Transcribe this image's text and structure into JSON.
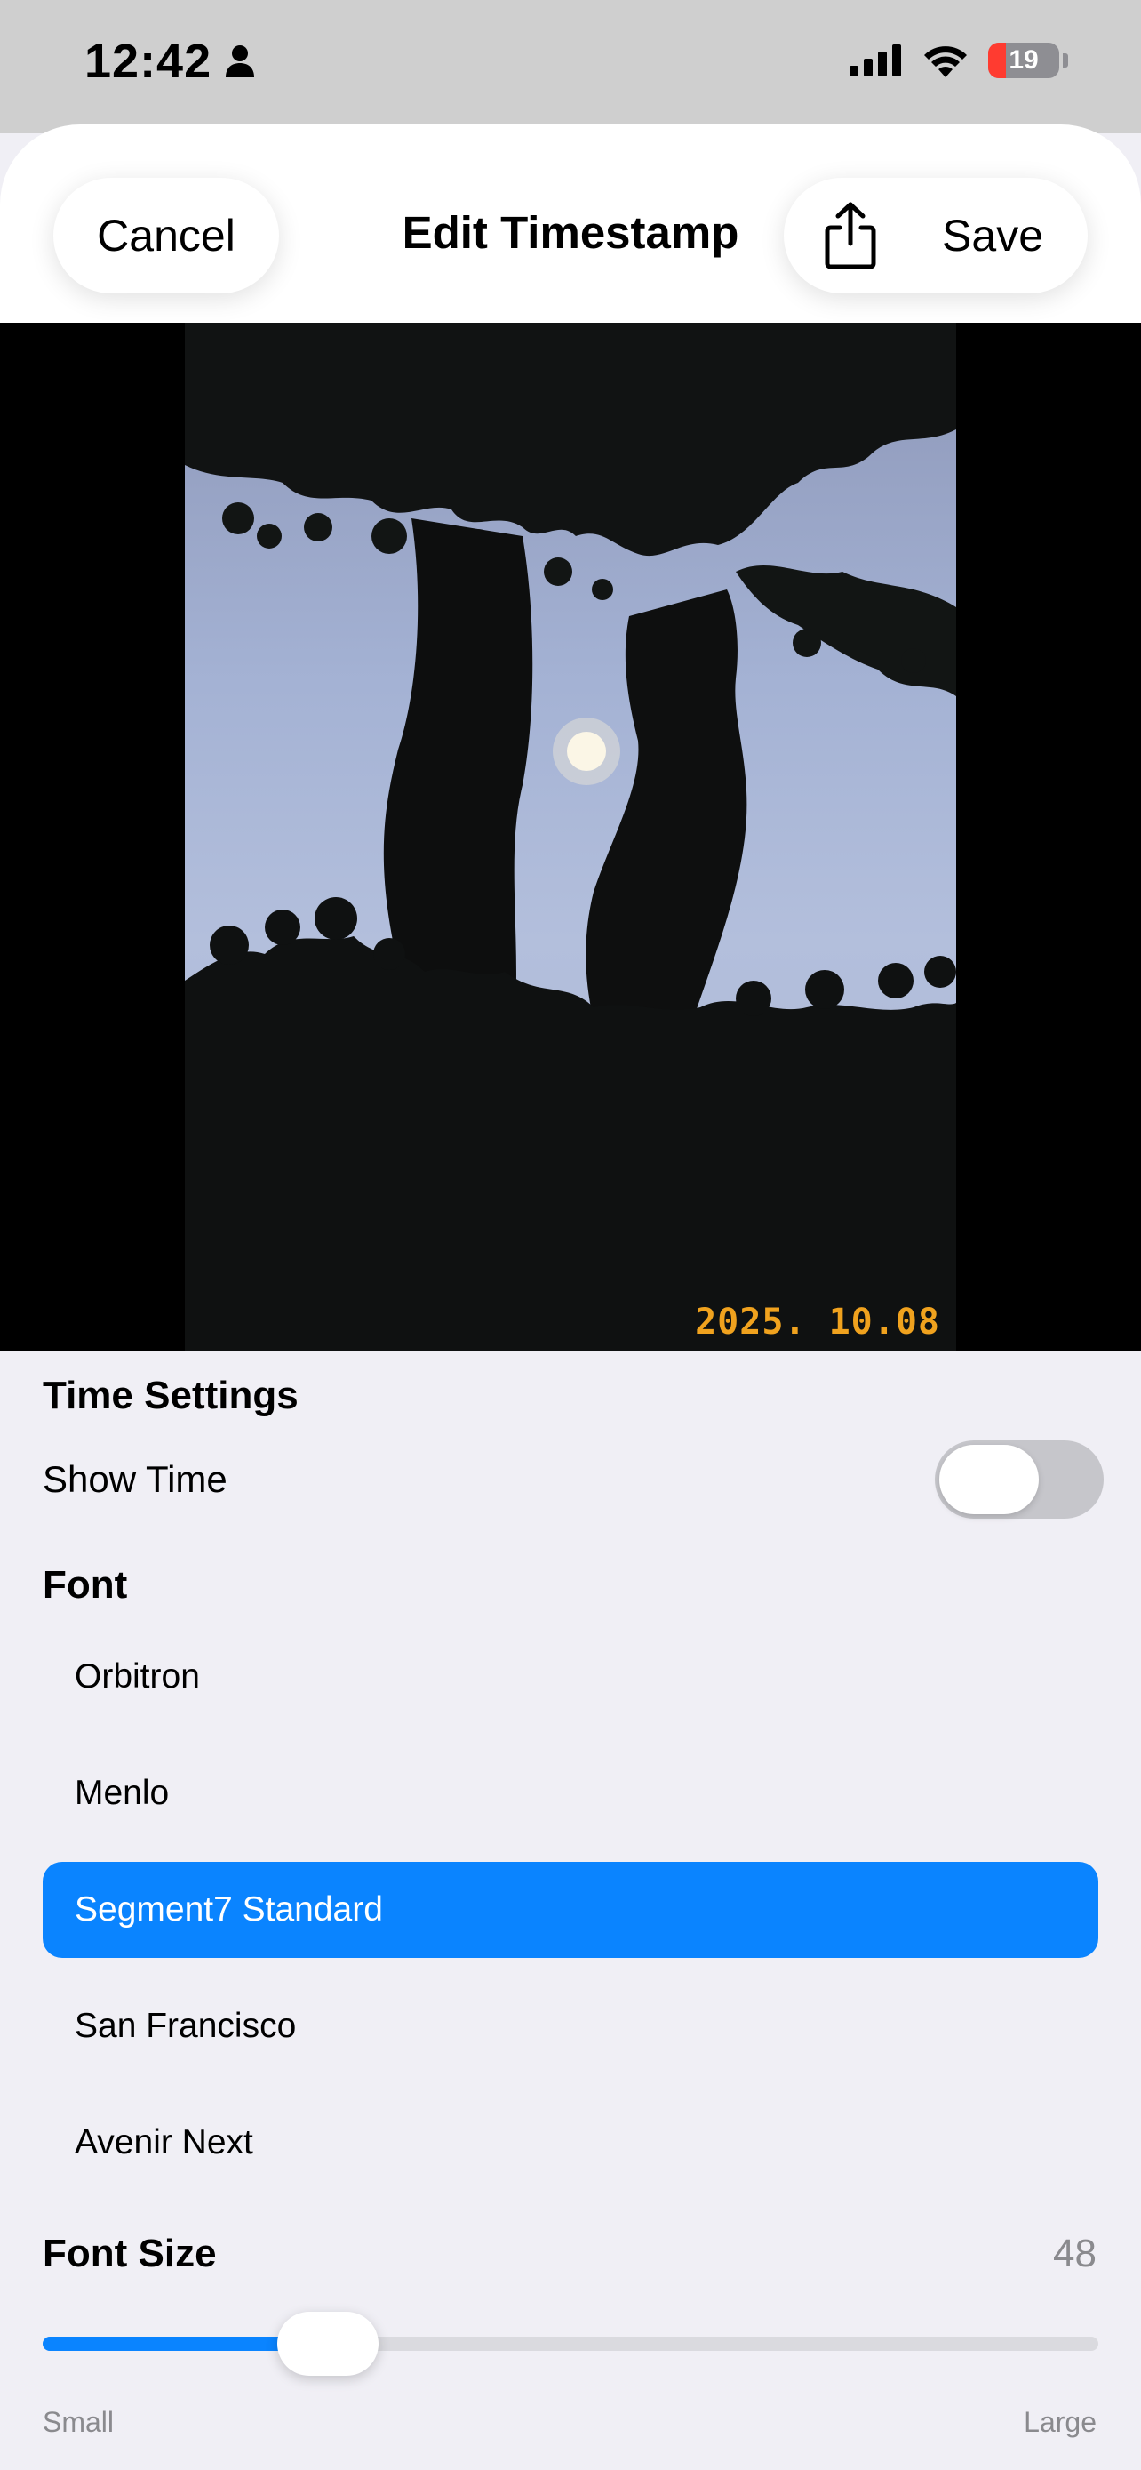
{
  "status_bar": {
    "time": "12:42",
    "battery": "19",
    "icons": [
      "person-icon",
      "cellular-icon",
      "wifi-icon",
      "battery-icon"
    ]
  },
  "header": {
    "cancel_label": "Cancel",
    "title": "Edit Timestamp",
    "save_label": "Save",
    "share_icon": "share-icon"
  },
  "preview": {
    "timestamp": "2025. 10.08",
    "timestamp_color": "#f0a21e"
  },
  "settings": {
    "time_section": "Time Settings",
    "show_time_label": "Show Time",
    "show_time_on": false,
    "font_section": "Font",
    "fonts": [
      "Orbitron",
      "Menlo",
      "Segment7 Standard",
      "San Francisco",
      "Avenir Next"
    ],
    "selected_font": "Segment7 Standard",
    "font_size_label": "Font Size",
    "font_size_value": "48",
    "font_size_fraction": 0.27,
    "slider_min_label": "Small",
    "slider_max_label": "Large",
    "accent_color": "#0a84ff"
  }
}
